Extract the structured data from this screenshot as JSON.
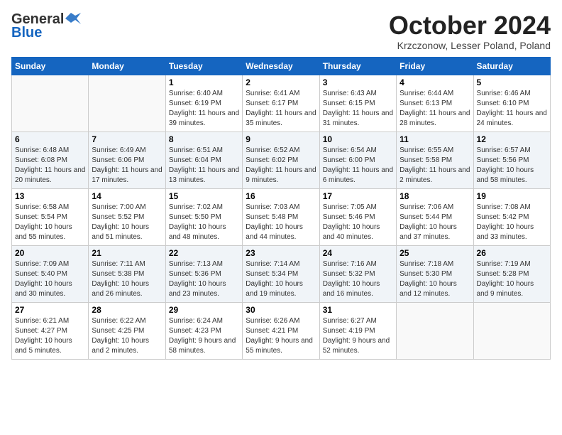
{
  "logo": {
    "general": "General",
    "blue": "Blue"
  },
  "title": "October 2024",
  "subtitle": "Krzczonow, Lesser Poland, Poland",
  "days_header": [
    "Sunday",
    "Monday",
    "Tuesday",
    "Wednesday",
    "Thursday",
    "Friday",
    "Saturday"
  ],
  "weeks": [
    [
      {
        "num": "",
        "detail": ""
      },
      {
        "num": "",
        "detail": ""
      },
      {
        "num": "1",
        "detail": "Sunrise: 6:40 AM\nSunset: 6:19 PM\nDaylight: 11 hours and 39 minutes."
      },
      {
        "num": "2",
        "detail": "Sunrise: 6:41 AM\nSunset: 6:17 PM\nDaylight: 11 hours and 35 minutes."
      },
      {
        "num": "3",
        "detail": "Sunrise: 6:43 AM\nSunset: 6:15 PM\nDaylight: 11 hours and 31 minutes."
      },
      {
        "num": "4",
        "detail": "Sunrise: 6:44 AM\nSunset: 6:13 PM\nDaylight: 11 hours and 28 minutes."
      },
      {
        "num": "5",
        "detail": "Sunrise: 6:46 AM\nSunset: 6:10 PM\nDaylight: 11 hours and 24 minutes."
      }
    ],
    [
      {
        "num": "6",
        "detail": "Sunrise: 6:48 AM\nSunset: 6:08 PM\nDaylight: 11 hours and 20 minutes."
      },
      {
        "num": "7",
        "detail": "Sunrise: 6:49 AM\nSunset: 6:06 PM\nDaylight: 11 hours and 17 minutes."
      },
      {
        "num": "8",
        "detail": "Sunrise: 6:51 AM\nSunset: 6:04 PM\nDaylight: 11 hours and 13 minutes."
      },
      {
        "num": "9",
        "detail": "Sunrise: 6:52 AM\nSunset: 6:02 PM\nDaylight: 11 hours and 9 minutes."
      },
      {
        "num": "10",
        "detail": "Sunrise: 6:54 AM\nSunset: 6:00 PM\nDaylight: 11 hours and 6 minutes."
      },
      {
        "num": "11",
        "detail": "Sunrise: 6:55 AM\nSunset: 5:58 PM\nDaylight: 11 hours and 2 minutes."
      },
      {
        "num": "12",
        "detail": "Sunrise: 6:57 AM\nSunset: 5:56 PM\nDaylight: 10 hours and 58 minutes."
      }
    ],
    [
      {
        "num": "13",
        "detail": "Sunrise: 6:58 AM\nSunset: 5:54 PM\nDaylight: 10 hours and 55 minutes."
      },
      {
        "num": "14",
        "detail": "Sunrise: 7:00 AM\nSunset: 5:52 PM\nDaylight: 10 hours and 51 minutes."
      },
      {
        "num": "15",
        "detail": "Sunrise: 7:02 AM\nSunset: 5:50 PM\nDaylight: 10 hours and 48 minutes."
      },
      {
        "num": "16",
        "detail": "Sunrise: 7:03 AM\nSunset: 5:48 PM\nDaylight: 10 hours and 44 minutes."
      },
      {
        "num": "17",
        "detail": "Sunrise: 7:05 AM\nSunset: 5:46 PM\nDaylight: 10 hours and 40 minutes."
      },
      {
        "num": "18",
        "detail": "Sunrise: 7:06 AM\nSunset: 5:44 PM\nDaylight: 10 hours and 37 minutes."
      },
      {
        "num": "19",
        "detail": "Sunrise: 7:08 AM\nSunset: 5:42 PM\nDaylight: 10 hours and 33 minutes."
      }
    ],
    [
      {
        "num": "20",
        "detail": "Sunrise: 7:09 AM\nSunset: 5:40 PM\nDaylight: 10 hours and 30 minutes."
      },
      {
        "num": "21",
        "detail": "Sunrise: 7:11 AM\nSunset: 5:38 PM\nDaylight: 10 hours and 26 minutes."
      },
      {
        "num": "22",
        "detail": "Sunrise: 7:13 AM\nSunset: 5:36 PM\nDaylight: 10 hours and 23 minutes."
      },
      {
        "num": "23",
        "detail": "Sunrise: 7:14 AM\nSunset: 5:34 PM\nDaylight: 10 hours and 19 minutes."
      },
      {
        "num": "24",
        "detail": "Sunrise: 7:16 AM\nSunset: 5:32 PM\nDaylight: 10 hours and 16 minutes."
      },
      {
        "num": "25",
        "detail": "Sunrise: 7:18 AM\nSunset: 5:30 PM\nDaylight: 10 hours and 12 minutes."
      },
      {
        "num": "26",
        "detail": "Sunrise: 7:19 AM\nSunset: 5:28 PM\nDaylight: 10 hours and 9 minutes."
      }
    ],
    [
      {
        "num": "27",
        "detail": "Sunrise: 6:21 AM\nSunset: 4:27 PM\nDaylight: 10 hours and 5 minutes."
      },
      {
        "num": "28",
        "detail": "Sunrise: 6:22 AM\nSunset: 4:25 PM\nDaylight: 10 hours and 2 minutes."
      },
      {
        "num": "29",
        "detail": "Sunrise: 6:24 AM\nSunset: 4:23 PM\nDaylight: 9 hours and 58 minutes."
      },
      {
        "num": "30",
        "detail": "Sunrise: 6:26 AM\nSunset: 4:21 PM\nDaylight: 9 hours and 55 minutes."
      },
      {
        "num": "31",
        "detail": "Sunrise: 6:27 AM\nSunset: 4:19 PM\nDaylight: 9 hours and 52 minutes."
      },
      {
        "num": "",
        "detail": ""
      },
      {
        "num": "",
        "detail": ""
      }
    ]
  ]
}
